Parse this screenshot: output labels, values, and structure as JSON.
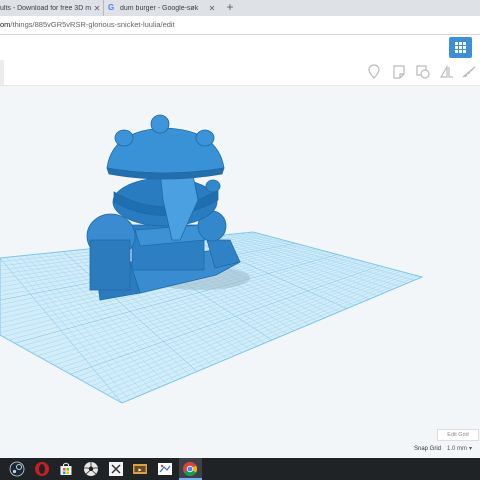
{
  "browser": {
    "tabs": [
      {
        "label": "ults - Download for free 3D m",
        "active": false
      },
      {
        "label": "dum burger - Google-søk",
        "active": false
      }
    ],
    "new_tab_glyph": "+",
    "close_glyph": "✕",
    "url_host": "om",
    "url_path": "/things/885vGR5vRSR-glorious-snicket-luulia/edit"
  },
  "app": {
    "grid_view_icon": "grid-view-icon",
    "toolbar_icons": [
      "location-pin-icon",
      "note-icon",
      "copy-icon",
      "mirror-icon",
      "ruler-icon"
    ]
  },
  "workplane": {
    "edit_grid_label": "Edit Grid",
    "snap_grid_label": "Snap Grid",
    "snap_grid_value": "1.0 mm",
    "grid_color": "#8fd0f0",
    "model_color": "#2a7fc2"
  },
  "taskbar": {
    "icons": [
      "steam-icon",
      "opera-icon",
      "store-icon",
      "soccer-ball-icon",
      "twitter-app-icon",
      "media-app-icon",
      "paint-app-icon",
      "chrome-icon"
    ]
  }
}
